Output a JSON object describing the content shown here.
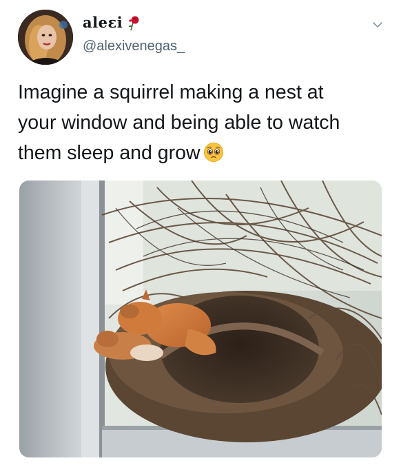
{
  "tweet": {
    "display_name": "aleɛi",
    "handle": "@alexivenegas_",
    "text_lines": [
      "Imagine a squirrel making a nest at",
      "your window and being able to watch",
      "them sleep and grow"
    ],
    "name_icon": "rose-icon",
    "text_emoji": "pleading-face-icon",
    "menu_icon": "chevron-down-icon",
    "media_description_icon": "photo"
  },
  "colors": {
    "text": "#14171a",
    "secondary_text": "#536471",
    "background": "#ffffff"
  }
}
